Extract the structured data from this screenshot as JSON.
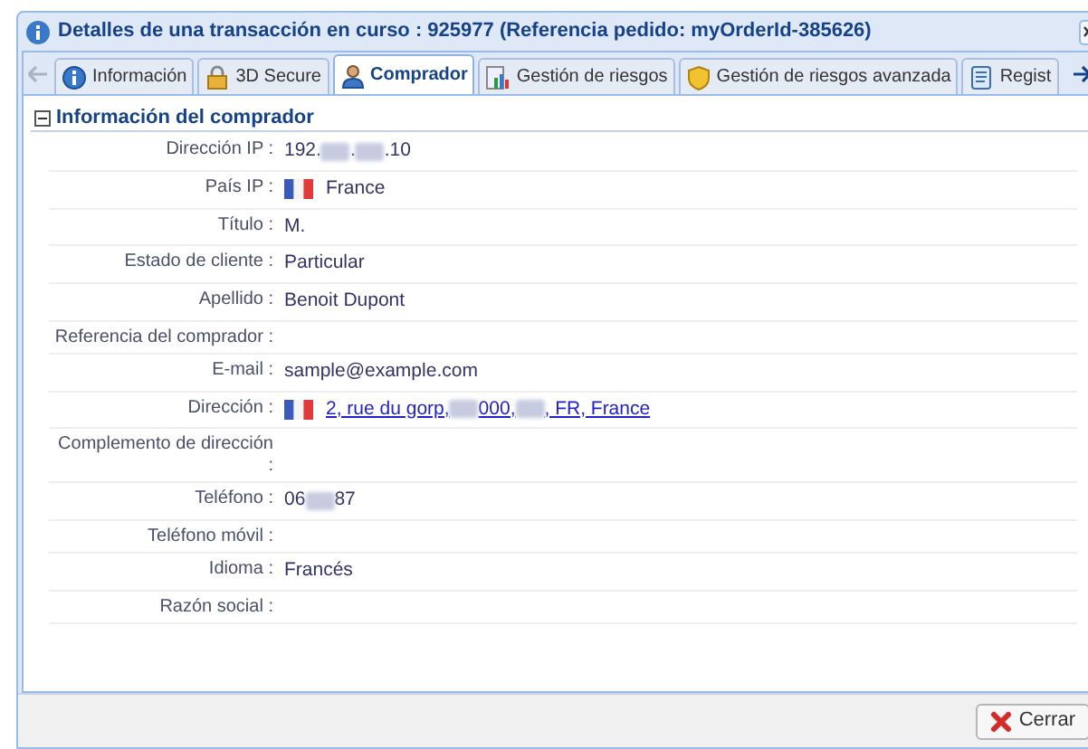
{
  "window": {
    "title": "Detalles de una transacción en curso : 925977 (Referencia pedido: myOrderId-385626)"
  },
  "tabs": [
    {
      "label": "Información",
      "selected": false
    },
    {
      "label": "3D Secure",
      "selected": false
    },
    {
      "label": "Comprador",
      "selected": true
    },
    {
      "label": "Gestión de riesgos",
      "selected": false
    },
    {
      "label": "Gestión de riesgos avanzada",
      "selected": false
    },
    {
      "label": "Regist",
      "selected": false
    }
  ],
  "section": {
    "title": "Información del comprador",
    "expanded": true
  },
  "rows": [
    {
      "label": "Dirección IP :",
      "link": false,
      "value": [
        {
          "kind": "text",
          "text": "192."
        },
        {
          "kind": "redacted"
        },
        {
          "kind": "text",
          "text": "."
        },
        {
          "kind": "redacted"
        },
        {
          "kind": "text",
          "text": ".10"
        }
      ]
    },
    {
      "label": "País IP :",
      "link": false,
      "value": [
        {
          "kind": "flag"
        },
        {
          "kind": "text",
          "text": "France"
        }
      ]
    },
    {
      "label": "Título :",
      "link": false,
      "value": [
        {
          "kind": "text",
          "text": "M."
        }
      ]
    },
    {
      "label": "Estado de cliente :",
      "link": false,
      "value": [
        {
          "kind": "text",
          "text": "Particular"
        }
      ]
    },
    {
      "label": "Apellido :",
      "link": false,
      "value": [
        {
          "kind": "text",
          "text": "Benoit Dupont"
        }
      ]
    },
    {
      "label": "Referencia del comprador :",
      "link": false,
      "value": []
    },
    {
      "label": "E-mail :",
      "link": false,
      "value": [
        {
          "kind": "text",
          "text": "sample@example.com"
        }
      ]
    },
    {
      "label": "Dirección :",
      "link": true,
      "value": [
        {
          "kind": "flag"
        },
        {
          "kind": "text",
          "text": "2, rue du gorp, "
        },
        {
          "kind": "redacted"
        },
        {
          "kind": "text",
          "text": "000, "
        },
        {
          "kind": "redacted"
        },
        {
          "kind": "text",
          "text": ", FR, France"
        }
      ]
    },
    {
      "label": "Complemento de dirección :",
      "link": false,
      "value": []
    },
    {
      "label": "Teléfono :",
      "link": false,
      "value": [
        {
          "kind": "text",
          "text": "06"
        },
        {
          "kind": "redacted"
        },
        {
          "kind": "text",
          "text": "87"
        }
      ]
    },
    {
      "label": "Teléfono móvil :",
      "link": false,
      "value": []
    },
    {
      "label": "Idioma :",
      "link": false,
      "value": [
        {
          "kind": "text",
          "text": "Francés"
        }
      ]
    },
    {
      "label": "Razón social :",
      "link": false,
      "value": []
    }
  ],
  "buttons": [
    {
      "label": "Cerrar"
    }
  ]
}
